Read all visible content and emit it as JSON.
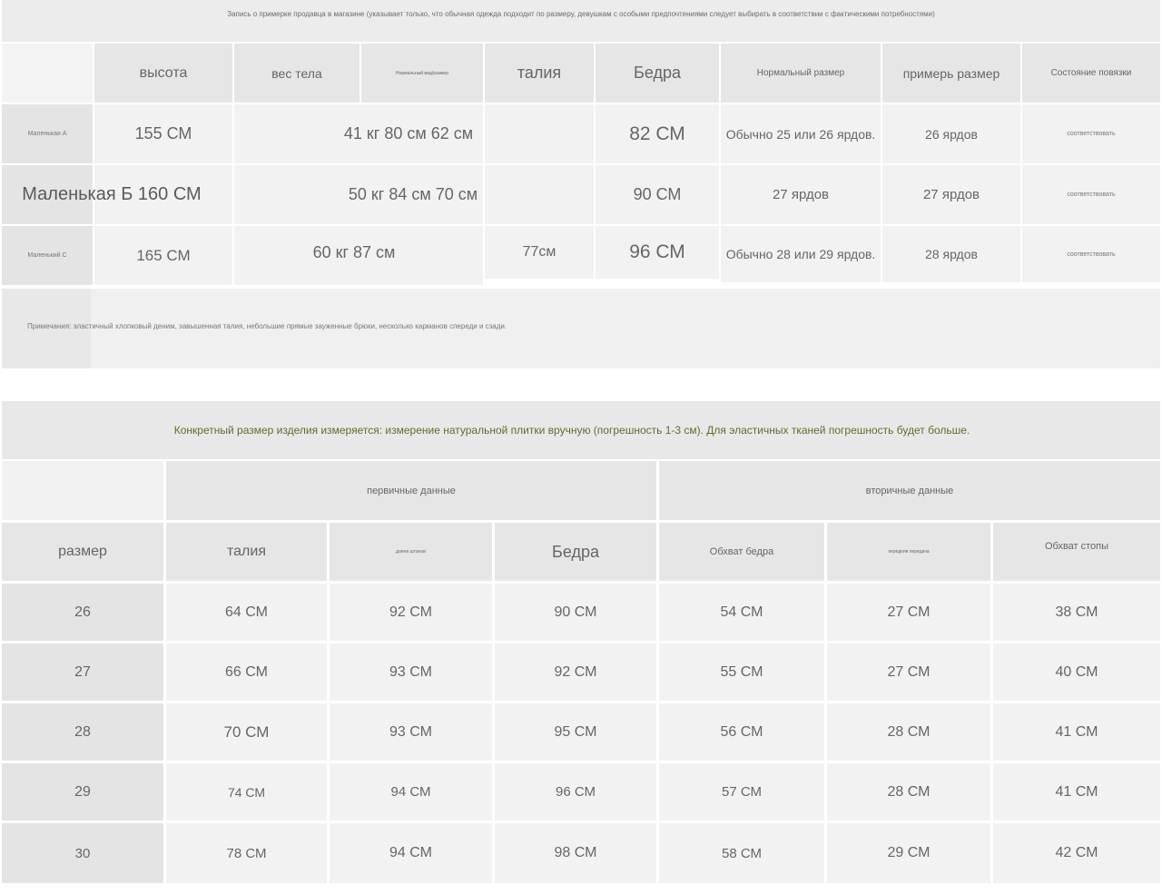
{
  "top_note": "Запись о примерке продавца в магазине (указывает только, что обычная одежда подходит по размеру, девушкам с особыми предпочтениями следует выбирать в соответствии с фактическими потребностями)",
  "table1": {
    "headers": {
      "height": "высота",
      "weight": "вес тела",
      "tiny": "Нормальный вид/размер",
      "waist": "талия",
      "hips": "Бедра",
      "normal_size": "Нормальный размер",
      "try_size": "примерь размер",
      "fit_state": "Состояние повязки"
    },
    "rows": [
      {
        "label": "Маленькая А",
        "height": "155 СМ",
        "weight_combo": "41 кг 80 см 62 см",
        "hips": "82 СМ",
        "normal": "Обычно 25 или 26 ярдов.",
        "try": "26 ярдов",
        "fit": "соответствовать"
      },
      {
        "label_combo": "Маленькая Б 160 СМ",
        "weight_combo": "50 кг 84 см 70 см",
        "hips": "90 СМ",
        "normal": "27 ярдов",
        "try": "27 ярдов",
        "fit": "соответствовать"
      },
      {
        "label": "Маленький С",
        "height": "165 СМ",
        "weight_combo": "60 кг 87 см",
        "waist": "77см",
        "hips": "96 СМ",
        "normal": "Обычно 28 или 29 ярдов.",
        "try": "28 ярдов",
        "fit": "соответствовать"
      }
    ],
    "notes": "Примечания: эластичный хлопковый деним, завышенная талия, небольшие прямые зауженные брюки, несколько карманов спереди и сзади."
  },
  "section2": {
    "title": "Конкретный размер изделия измеряется: измерение натуральной плитки вручную (погрешность 1-3 см). Для эластичных тканей погрешность будет больше.",
    "group_primary": "первичные данные",
    "group_secondary": "вторичные данные",
    "headers": {
      "size": "размер",
      "waist": "талия",
      "length": "длина штанов",
      "hips": "Бедра",
      "thigh": "Обхват бедра",
      "rise": "передняя передача",
      "foot": "Обхват стопы"
    },
    "rows": [
      {
        "size": "26",
        "waist": "64 СМ",
        "length": "92 СМ",
        "hips": "90 СМ",
        "thigh": "54 СМ",
        "rise": "27 СМ",
        "foot": "38 СМ"
      },
      {
        "size": "27",
        "waist": "66 СМ",
        "length": "93 СМ",
        "hips": "92 СМ",
        "thigh": "55 СМ",
        "rise": "27 СМ",
        "foot": "40 СМ"
      },
      {
        "size": "28",
        "waist": "70 СМ",
        "length": "93 СМ",
        "hips": "95 СМ",
        "thigh": "56 СМ",
        "rise": "28 СМ",
        "foot": "41 СМ"
      },
      {
        "size": "29",
        "waist": "74 СМ",
        "length": "94 СМ",
        "hips": "96 СМ",
        "thigh": "57 СМ",
        "rise": "28 СМ",
        "foot": "41 СМ"
      },
      {
        "size": "30",
        "waist": "78 СМ",
        "length": "94 СМ",
        "hips": "98 СМ",
        "thigh": "58 СМ",
        "rise": "29 СМ",
        "foot": "42 СМ"
      }
    ]
  }
}
